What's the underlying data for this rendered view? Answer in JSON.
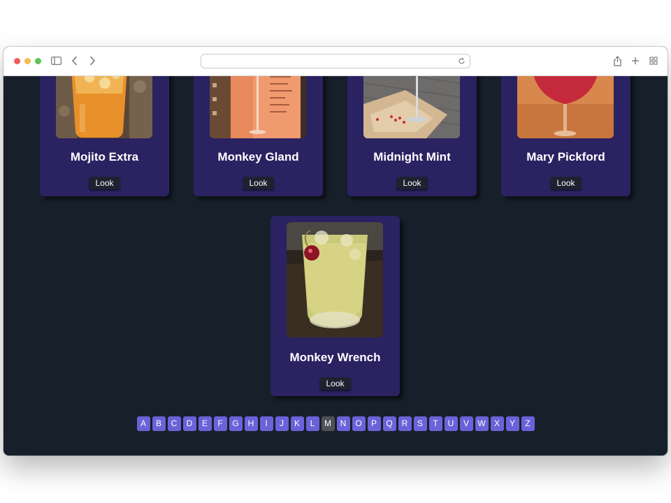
{
  "browser": {
    "address_value": ""
  },
  "cocktails": [
    {
      "name": "Mojito Extra",
      "button": "Look"
    },
    {
      "name": "Monkey Gland",
      "button": "Look"
    },
    {
      "name": "Midnight Mint",
      "button": "Look"
    },
    {
      "name": "Mary Pickford",
      "button": "Look"
    },
    {
      "name": "Monkey Wrench",
      "button": "Look"
    }
  ],
  "alphabet": {
    "letters": [
      "A",
      "B",
      "C",
      "D",
      "E",
      "F",
      "G",
      "H",
      "I",
      "J",
      "K",
      "L",
      "M",
      "N",
      "O",
      "P",
      "Q",
      "R",
      "S",
      "T",
      "U",
      "V",
      "W",
      "X",
      "Y",
      "Z"
    ],
    "active": "M"
  },
  "colors": {
    "page_background": "#17202a",
    "card_background": "#2b2262",
    "letter_background": "#6a62d8",
    "letter_active": "#505058",
    "button_background": "#1e2230"
  }
}
